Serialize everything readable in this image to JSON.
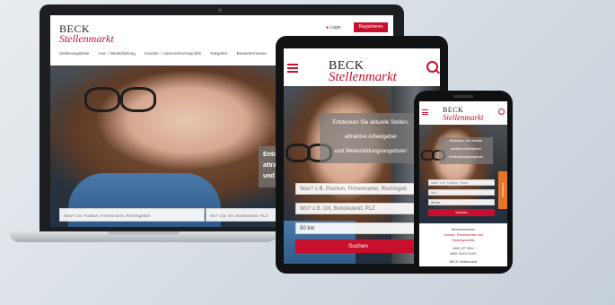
{
  "brand": {
    "line1": "BECK",
    "line2": "Stellenmarkt",
    "accent": "#c8102e"
  },
  "laptop": {
    "login": "Login",
    "register": "Registrieren",
    "nav": [
      "Stellenangebote",
      "Aus- / Weiterbildung",
      "Kanzlei- / Unternehmensprofile",
      "Ratgeber",
      "Bewerbermesse"
    ],
    "overlay_lines": [
      "Entdeck",
      "attrakt",
      "und We"
    ],
    "what_placeholder": "Was? z.B. Position, Firmenname, Rechtsgebiet",
    "where_placeholder": "Wo? z.B. Ort, Bundesland, PLZ"
  },
  "tablet": {
    "overlay_lines": [
      "Entdecken Sie aktuelle Stellen,",
      "attraktive Arbeitgeber",
      "und Weiterbildungsangebote!"
    ],
    "what_placeholder": "Was? z.B. Position, Firmenname, Rechtsgeb",
    "where_placeholder": "Wo? z.B. Ort, Bundesland, PLZ",
    "radius": "50 km",
    "search": "Suchen"
  },
  "phone": {
    "overlay_lines": [
      "Entdecken Sie aktuelle",
      "attraktive Arbeitgeber",
      "Weiterbildungsangebote"
    ],
    "what_placeholder": "Was? z.B. Position, Firme",
    "where_placeholder": "Wo?",
    "radius": "50 km",
    "search": "Suchen",
    "promo_lines": [
      "Bewerbermesse",
      "Juristen, Steuerberater und",
      "Fachangestellte"
    ],
    "small_lines": [
      "WAS IST NEU",
      "0800 XXXX XXXX",
      "BECK Stellenmarkt"
    ],
    "side_tab": "Feedback"
  }
}
